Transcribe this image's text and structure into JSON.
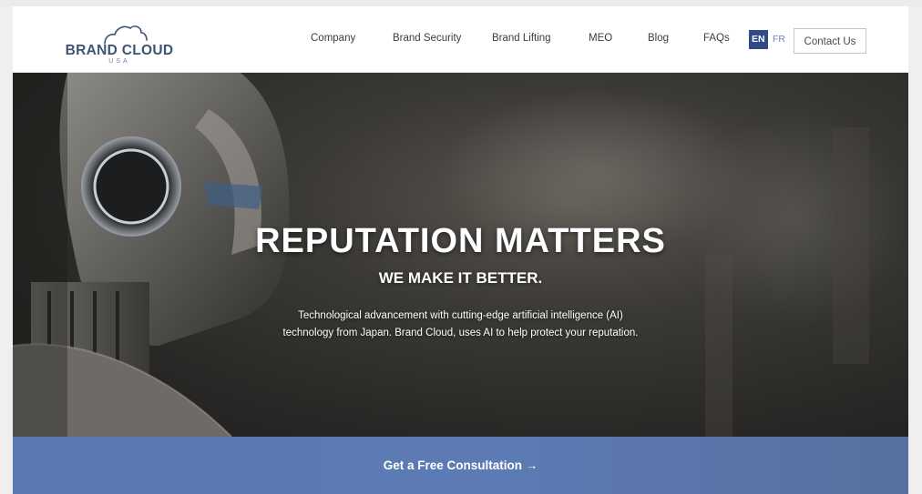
{
  "brand": {
    "name": "BRAND CLOUD",
    "sub": "USA"
  },
  "nav": {
    "items": [
      {
        "label": "Company"
      },
      {
        "label": "Brand Security"
      },
      {
        "label": "Brand Lifting"
      },
      {
        "label": "MEO"
      },
      {
        "label": "Blog"
      },
      {
        "label": "FAQs"
      }
    ],
    "lang_en": "EN",
    "lang_fr": "FR",
    "contact_label": "Contact Us"
  },
  "hero": {
    "title": "REPUTATION MATTERS",
    "subtitle": "WE MAKE IT BETTER.",
    "desc_line1": "Technological advancement with cutting-edge artificial intelligence (AI)",
    "desc_line2": "technology from Japan. Brand Cloud, uses AI to help protect your reputation."
  },
  "cta": {
    "label": "Get a Free Consultation →"
  },
  "colors": {
    "brand_text": "#3d5573",
    "lang_active": "#2f4a86",
    "cta_bg": "#5a78b2"
  }
}
